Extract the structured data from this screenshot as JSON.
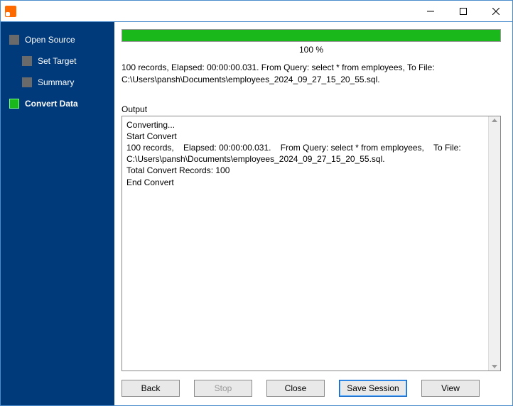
{
  "sidebar": {
    "items": [
      {
        "label": "Open Source"
      },
      {
        "label": "Set Target"
      },
      {
        "label": "Summary"
      },
      {
        "label": "Convert Data"
      }
    ]
  },
  "progress": {
    "percent_label": "100 %"
  },
  "summary": {
    "line1": "100 records,    Elapsed: 00:00:00.031.    From Query: select * from employees,    To File:",
    "line2": "C:\\Users\\pansh\\Documents\\employees_2024_09_27_15_20_55.sql."
  },
  "output": {
    "label": "Output",
    "text": "Converting...\nStart Convert\n100 records,    Elapsed: 00:00:00.031.    From Query: select * from employees,    To File: C:\\Users\\pansh\\Documents\\employees_2024_09_27_15_20_55.sql.\nTotal Convert Records: 100\nEnd Convert"
  },
  "buttons": {
    "back": "Back",
    "stop": "Stop",
    "close": "Close",
    "save_session": "Save Session",
    "view": "View"
  }
}
